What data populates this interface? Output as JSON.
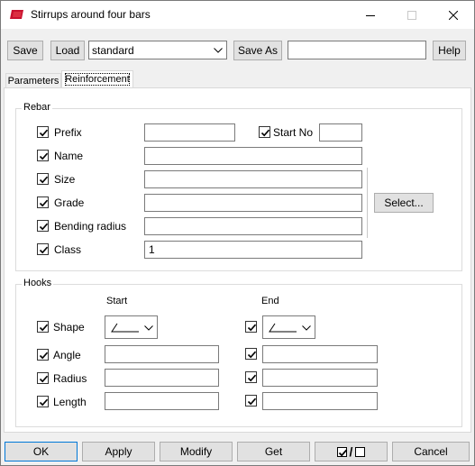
{
  "window": {
    "title": "Stirrups around four bars",
    "icon": "tekla-red-flag-icon",
    "controls": [
      "minimize-icon",
      "maximize-icon",
      "close-icon"
    ]
  },
  "toolbar": {
    "save_label": "Save",
    "load_label": "Load",
    "preset_value": "standard",
    "save_as_label": "Save As",
    "save_as_value": "",
    "help_label": "Help"
  },
  "tabs": [
    {
      "label": "Parameters",
      "active": false
    },
    {
      "label": "Reinforcement",
      "active": true
    }
  ],
  "rebar": {
    "title": "Rebar",
    "prefix": {
      "label": "Prefix",
      "checked": true,
      "value": ""
    },
    "start_no": {
      "label": "Start No",
      "checked": true,
      "value": ""
    },
    "name": {
      "label": "Name",
      "checked": true,
      "value": ""
    },
    "size": {
      "label": "Size",
      "checked": true,
      "value": ""
    },
    "grade": {
      "label": "Grade",
      "checked": true,
      "value": ""
    },
    "bending_radius": {
      "label": "Bending radius",
      "checked": true,
      "value": ""
    },
    "class": {
      "label": "Class",
      "checked": true,
      "value": "1"
    },
    "select_label": "Select..."
  },
  "hooks": {
    "title": "Hooks",
    "start_header": "Start",
    "end_header": "End",
    "shape": {
      "label": "Shape",
      "checked": true,
      "end_checked": true
    },
    "angle": {
      "label": "Angle",
      "checked": true,
      "start_value": "",
      "end_checked": true,
      "end_value": ""
    },
    "radius": {
      "label": "Radius",
      "checked": true,
      "start_value": "",
      "end_checked": true,
      "end_value": ""
    },
    "length": {
      "label": "Length",
      "checked": true,
      "start_value": "",
      "end_checked": true,
      "end_value": ""
    }
  },
  "buttons": {
    "ok": "OK",
    "apply": "Apply",
    "modify": "Modify",
    "get": "Get",
    "toggle_separator": "/",
    "cancel": "Cancel"
  },
  "colors": {
    "accent": "#0078d7",
    "icon_red": "#c8102e"
  }
}
